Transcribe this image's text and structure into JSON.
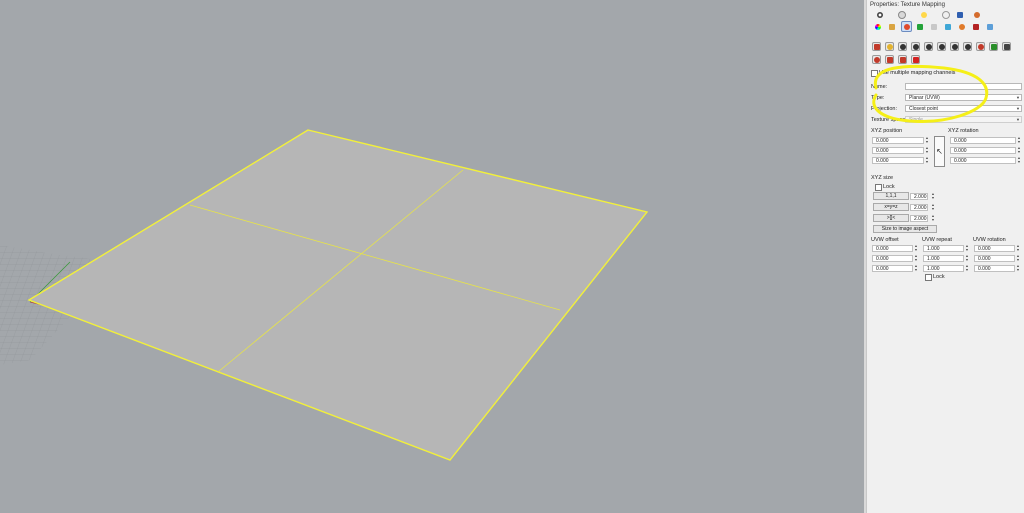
{
  "panel": {
    "title": "Properties: Texture Mapping",
    "use_multiple_label": "Use multiple mapping channels",
    "name_label": "Name:",
    "name_value": "",
    "type_label": "Type:",
    "type_value": "Planar (UVW)",
    "projection_label": "Projection:",
    "projection_value": "Closest point",
    "texture_space_label": "Texture space:",
    "texture_space_value": "Single",
    "xyz_position_label": "XYZ position",
    "xyz_rotation_label": "XYZ rotation",
    "xyz_position": [
      "0.000",
      "0.000",
      "0.000"
    ],
    "xyz_rotation": [
      "0.000",
      "0.000",
      "0.000"
    ],
    "xyz_size_label": "XYZ size",
    "lock_label": "Lock",
    "size_buttons": [
      "1,1,1",
      "x=y=z",
      ">[]<"
    ],
    "xyz_size": [
      "2.000",
      "2.000",
      "2.000"
    ],
    "size_to_image_label": "Size to image aspect",
    "uvw_offset_label": "UVW offset",
    "uvw_repeat_label": "UVW repeat",
    "uvw_rotation_label": "UVW rotation",
    "uvw_offset": [
      "0.000",
      "0.000",
      "0.000"
    ],
    "uvw_repeat": [
      "1.000",
      "1.000",
      "1.000"
    ],
    "uvw_rotation": [
      "0.000",
      "0.000",
      "0.000"
    ],
    "uvw_lock_label": "Lock"
  },
  "icons": {
    "row1": [
      "object-icon",
      "material-icon",
      "light-icon",
      "color-icon",
      "display-icon",
      "teapot-icon"
    ],
    "row2": [
      "color-wheel-icon",
      "brush-icon",
      "texture-mapping-icon",
      "decal-icon",
      "primitive-icon",
      "cube-icon",
      "sphere-icon",
      "box-icon",
      "cylinder-icon"
    ],
    "row3": [
      "mapping-widget-icon",
      "apply-planar-icon",
      "apply-box-icon",
      "apply-spherical-icon",
      "apply-cylindrical-icon",
      "apply-surface-icon",
      "apply-custom-icon",
      "match-mapping-icon",
      "remove-mapping-icon",
      "show-mapping-icon",
      "extract-mapping-icon"
    ],
    "row4": [
      "unwrap-icon",
      "rotate-mapping-icon",
      "move-mapping-icon",
      "delete-mapping-icon"
    ]
  },
  "colors": {
    "viewport_bg": "#a3a7ab",
    "plane_fill": "#b6b6b6",
    "selection_yellow": "#f2f03a",
    "highlight_yellow": "#f5ef18"
  }
}
